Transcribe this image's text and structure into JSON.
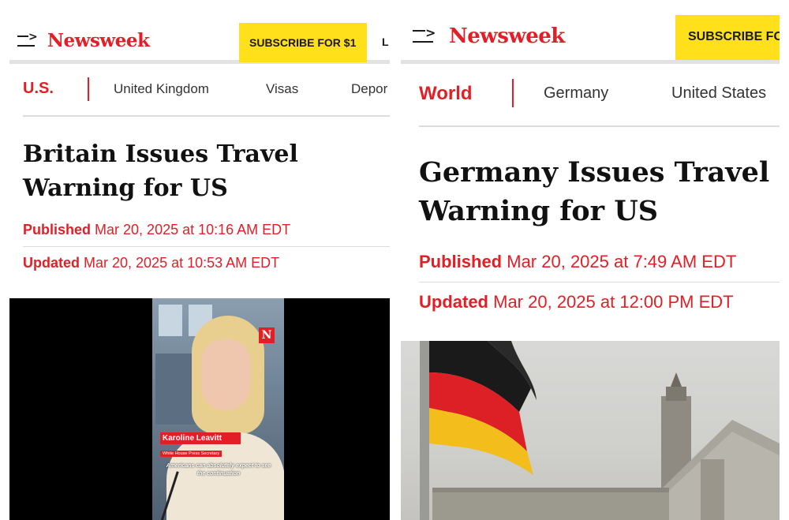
{
  "left": {
    "logo": "Newsweek",
    "subscribe_label": "SUBSCRIBE FOR $1",
    "login_label": "L",
    "nav": {
      "section": "U.S.",
      "links": [
        "United Kingdom",
        "Visas",
        "Depor"
      ]
    },
    "headline": "Britain Issues Travel Warning for US",
    "published": {
      "label": "Published",
      "value": "Mar 20, 2025 at 10:16 AM EDT"
    },
    "updated": {
      "label": "Updated",
      "value": "Mar 20, 2025 at 10:53 AM EDT"
    },
    "video": {
      "badge": "N",
      "name": "Karoline Leavitt",
      "role": "White House Press Secretary",
      "caption": "Americans can absolutely expect to see the continuation"
    }
  },
  "right": {
    "logo": "Newsweek",
    "subscribe_label": "SUBSCRIBE FO",
    "nav": {
      "section": "World",
      "links": [
        "Germany",
        "United States"
      ]
    },
    "headline": "Germany Issues Travel Warning for US",
    "published": {
      "label": "Published",
      "value": "Mar 20, 2025 at 7:49 AM EDT"
    },
    "updated": {
      "label": "Updated",
      "value": "Mar 20, 2025 at 12:00 PM EDT"
    }
  },
  "colors": {
    "brand_red": "#e21f26",
    "subscribe_yellow": "#ffe01b",
    "flag_black": "#1a1a1a",
    "flag_red": "#dd1f26",
    "flag_gold": "#f3bd1c"
  }
}
